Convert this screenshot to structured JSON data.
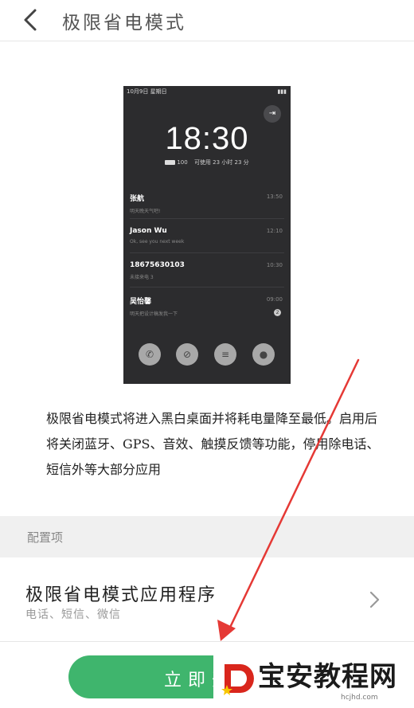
{
  "header": {
    "title": "极限省电模式"
  },
  "phone_preview": {
    "status_date": "10月9日 星期日",
    "signal": "▮▮▮",
    "time": "18:30",
    "battery_level": "100",
    "battery_text": "可使用 23 小时 23 分",
    "messages": [
      {
        "name": "张航",
        "text": "明天晚天气吧!",
        "when": "13:50"
      },
      {
        "name": "Jason Wu",
        "text": "Ok, see you next week",
        "when": "12:10"
      },
      {
        "name": "18675630103",
        "text": "未接来电 3",
        "when": "10:30"
      },
      {
        "name": "吴怡馨",
        "text": "明天把设计稿发我一下",
        "when": "09:00",
        "badge": "2"
      }
    ]
  },
  "description": "极限省电模式将进入黑白桌面并将耗电量降至最低。启用后将关闭蓝牙、GPS、音效、触摸反馈等功能，停用除电话、短信外等大部分应用",
  "config": {
    "section_label": "配置项",
    "row_title": "极限省电模式应用程序",
    "row_subtitle": "电话、短信、微信"
  },
  "action": {
    "button_label": "立即开启"
  },
  "watermark": {
    "text": "宝安教程网",
    "url": "hcjhd.com"
  },
  "colors": {
    "accent": "#3fb56d",
    "arrow": "#e53935"
  }
}
